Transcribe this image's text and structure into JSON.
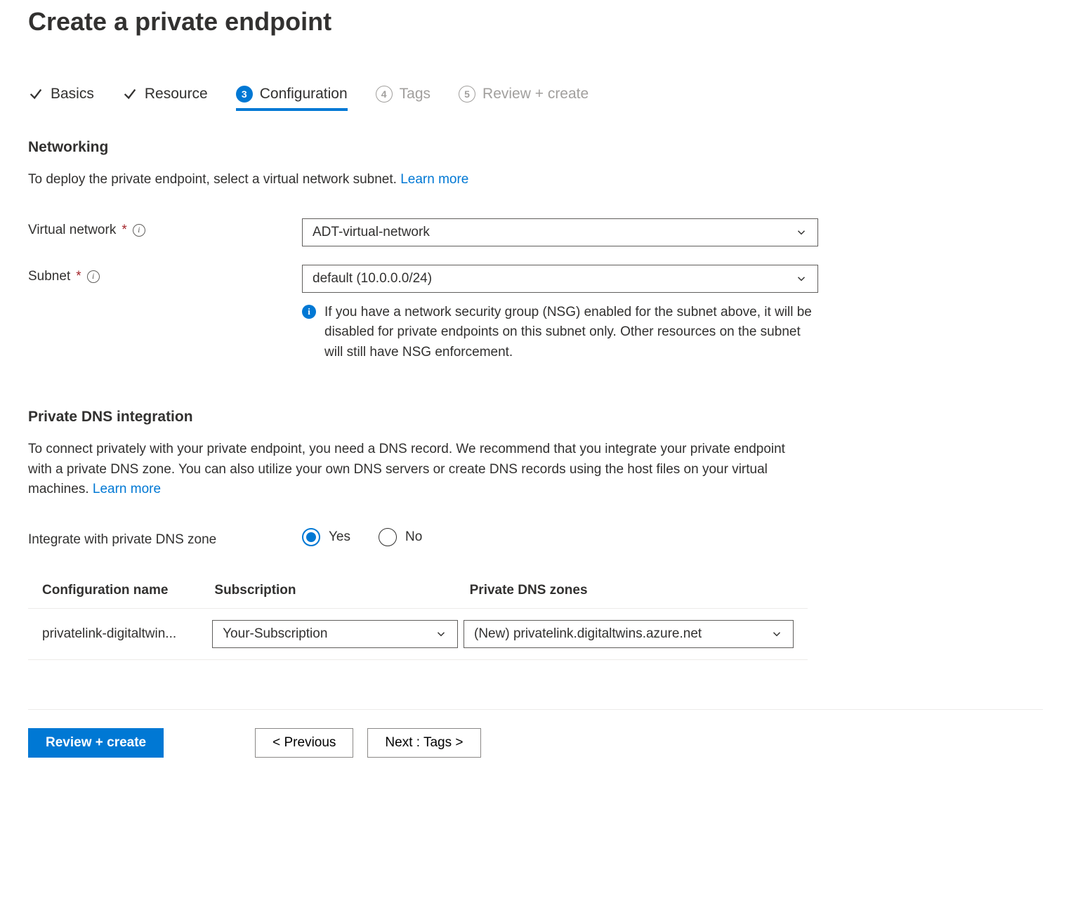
{
  "page_title": "Create a private endpoint",
  "tabs": {
    "basics": "Basics",
    "resource": "Resource",
    "configuration": {
      "num": "3",
      "label": "Configuration"
    },
    "tags": {
      "num": "4",
      "label": "Tags"
    },
    "review": {
      "num": "5",
      "label": "Review + create"
    }
  },
  "networking": {
    "heading": "Networking",
    "desc": "To deploy the private endpoint, select a virtual network subnet.  ",
    "learn_more": "Learn more",
    "vnet_label": "Virtual network",
    "vnet_value": "ADT-virtual-network",
    "subnet_label": "Subnet",
    "subnet_value": "default (10.0.0.0/24)",
    "nsg_info": "If you have a network security group (NSG) enabled for the subnet above, it will be disabled for private endpoints on this subnet only. Other resources on the subnet will still have NSG enforcement."
  },
  "dns": {
    "heading": "Private DNS integration",
    "desc": "To connect privately with your private endpoint, you need a DNS record. We recommend that you integrate your private endpoint with a private DNS zone. You can also utilize your own DNS servers or create DNS records using the host files on your virtual machines.  ",
    "learn_more": "Learn more",
    "integrate_label": "Integrate with private DNS zone",
    "yes": "Yes",
    "no": "No"
  },
  "table": {
    "col1": "Configuration name",
    "col2": "Subscription",
    "col3": "Private DNS zones",
    "row": {
      "config_name": "privatelink-digitaltwin...",
      "subscription": "Your-Subscription",
      "dns_zone": "(New) privatelink.digitaltwins.azure.net"
    }
  },
  "footer": {
    "review": "Review + create",
    "prev": "< Previous",
    "next": "Next : Tags >"
  }
}
